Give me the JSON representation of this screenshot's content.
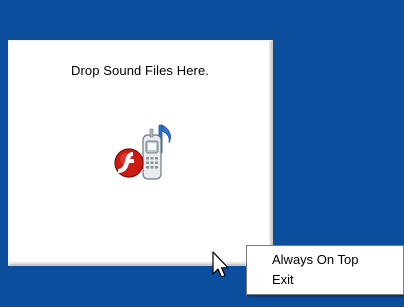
{
  "drop_window": {
    "title": "Drop Sound Files Here."
  },
  "icons": {
    "app_icon": "flash-phone-music-icon",
    "cursor": "mouse-pointer-icon"
  },
  "context_menu": {
    "items": [
      {
        "label": "Always On Top"
      },
      {
        "label": "Exit"
      }
    ]
  },
  "colors": {
    "desktop_background": "#0b4e9e",
    "window_background": "#ffffff",
    "menu_background": "#ffffff"
  }
}
